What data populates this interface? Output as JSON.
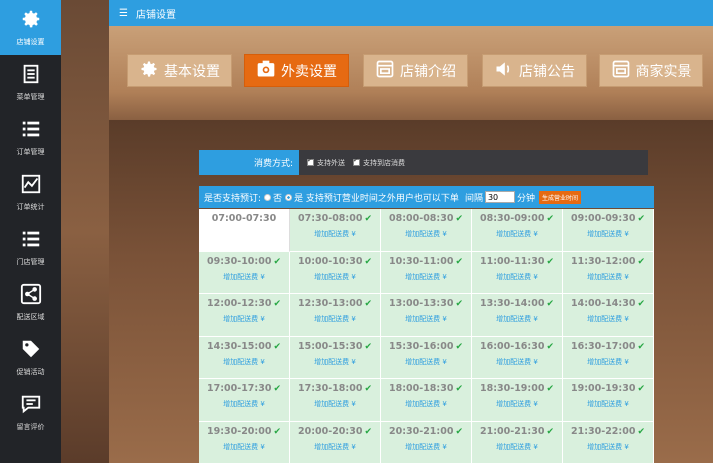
{
  "sidebar": {
    "items": [
      {
        "label": "店铺设置",
        "icon": "gear-icon",
        "active": true
      },
      {
        "label": "菜单管理",
        "icon": "document-icon",
        "active": false
      },
      {
        "label": "订单管理",
        "icon": "list-icon",
        "active": false
      },
      {
        "label": "订单统计",
        "icon": "chart-icon",
        "active": false
      },
      {
        "label": "门店管理",
        "icon": "list-icon",
        "active": false
      },
      {
        "label": "配送区域",
        "icon": "share-icon",
        "active": false
      },
      {
        "label": "促销活动",
        "icon": "tag-icon",
        "active": false
      },
      {
        "label": "留言评价",
        "icon": "message-icon",
        "active": false
      }
    ]
  },
  "topbar": {
    "title": "店铺设置"
  },
  "tabs": [
    {
      "label": "基本设置",
      "icon": "gear-icon",
      "active": false
    },
    {
      "label": "外卖设置",
      "icon": "camera-icon",
      "active": true
    },
    {
      "label": "店铺介绍",
      "icon": "window-icon",
      "active": false
    },
    {
      "label": "店铺公告",
      "icon": "speaker-icon",
      "active": false
    },
    {
      "label": "商家实景",
      "icon": "window-icon",
      "active": false
    }
  ],
  "fee_row": {
    "label": "消费方式:",
    "options": [
      "支持外送",
      "支持到店消费"
    ]
  },
  "reservation": {
    "question": "是否支持预订:",
    "no_label": "否",
    "yes_label": "是 支持预订营业时间之外用户也可以下单",
    "interval_label": "间隔",
    "interval_value": "30",
    "unit": "分钟",
    "generate_button": "生成营业时间"
  },
  "slots": [
    {
      "time": "07:00-07:30",
      "fee": "",
      "checked": false
    },
    {
      "time": "07:30-08:00",
      "fee": "增加配送费 ¥",
      "checked": true
    },
    {
      "time": "08:00-08:30",
      "fee": "增加配送费 ¥",
      "checked": true
    },
    {
      "time": "08:30-09:00",
      "fee": "增加配送费 ¥",
      "checked": true
    },
    {
      "time": "09:00-09:30",
      "fee": "增加配送费 ¥",
      "checked": true
    },
    {
      "time": "09:30-10:00",
      "fee": "增加配送费 ¥",
      "checked": true
    },
    {
      "time": "10:00-10:30",
      "fee": "增加配送费 ¥",
      "checked": true
    },
    {
      "time": "10:30-11:00",
      "fee": "增加配送费 ¥",
      "checked": true
    },
    {
      "time": "11:00-11:30",
      "fee": "增加配送费 ¥",
      "checked": true
    },
    {
      "time": "11:30-12:00",
      "fee": "增加配送费 ¥",
      "checked": true
    },
    {
      "time": "12:00-12:30",
      "fee": "增加配送费 ¥",
      "checked": true
    },
    {
      "time": "12:30-13:00",
      "fee": "增加配送费 ¥",
      "checked": true
    },
    {
      "time": "13:00-13:30",
      "fee": "增加配送费 ¥",
      "checked": true
    },
    {
      "time": "13:30-14:00",
      "fee": "增加配送费 ¥",
      "checked": true
    },
    {
      "time": "14:00-14:30",
      "fee": "增加配送费 ¥",
      "checked": true
    },
    {
      "time": "14:30-15:00",
      "fee": "增加配送费 ¥",
      "checked": true
    },
    {
      "time": "15:00-15:30",
      "fee": "增加配送费 ¥",
      "checked": true
    },
    {
      "time": "15:30-16:00",
      "fee": "增加配送费 ¥",
      "checked": true
    },
    {
      "time": "16:00-16:30",
      "fee": "增加配送费 ¥",
      "checked": true
    },
    {
      "time": "16:30-17:00",
      "fee": "增加配送费 ¥",
      "checked": true
    },
    {
      "time": "17:00-17:30",
      "fee": "增加配送费 ¥",
      "checked": true
    },
    {
      "time": "17:30-18:00",
      "fee": "增加配送费 ¥",
      "checked": true
    },
    {
      "time": "18:00-18:30",
      "fee": "增加配送费 ¥",
      "checked": true
    },
    {
      "time": "18:30-19:00",
      "fee": "增加配送费 ¥",
      "checked": true
    },
    {
      "time": "19:00-19:30",
      "fee": "增加配送费 ¥",
      "checked": true
    },
    {
      "time": "19:30-20:00",
      "fee": "增加配送费 ¥",
      "checked": true
    },
    {
      "time": "20:00-20:30",
      "fee": "增加配送费 ¥",
      "checked": true
    },
    {
      "time": "20:30-21:00",
      "fee": "增加配送费 ¥",
      "checked": true
    },
    {
      "time": "21:00-21:30",
      "fee": "增加配送费 ¥",
      "checked": true
    },
    {
      "time": "21:30-22:00",
      "fee": "增加配送费 ¥",
      "checked": true
    }
  ],
  "colors": {
    "accent": "#2e9ee0",
    "active_tab": "#e66a12",
    "slot_bg": "#d9f0dd"
  }
}
